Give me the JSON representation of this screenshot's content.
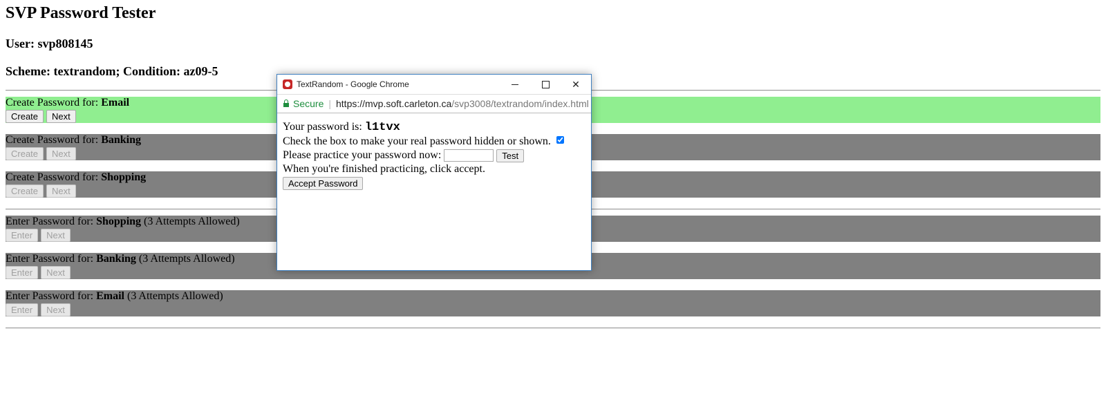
{
  "header": {
    "title": "SVP Password Tester",
    "user_line": "User: svp808145",
    "scheme_line": "Scheme: textrandom; Condition: az09-5"
  },
  "create_rows": [
    {
      "prefix": "Create Password for: ",
      "account": "Email",
      "create_label": "Create",
      "next_label": "Next",
      "state": "active"
    },
    {
      "prefix": "Create Password for: ",
      "account": "Banking",
      "create_label": "Create",
      "next_label": "Next",
      "state": "disabled"
    },
    {
      "prefix": "Create Password for: ",
      "account": "Shopping",
      "create_label": "Create",
      "next_label": "Next",
      "state": "disabled"
    }
  ],
  "enter_rows": [
    {
      "prefix": "Enter Password for: ",
      "account": "Shopping",
      "suffix": " (3 Attempts Allowed)",
      "enter_label": "Enter",
      "next_label": "Next"
    },
    {
      "prefix": "Enter Password for: ",
      "account": "Banking",
      "suffix": " (3 Attempts Allowed)",
      "enter_label": "Enter",
      "next_label": "Next"
    },
    {
      "prefix": "Enter Password for: ",
      "account": "Email",
      "suffix": " (3 Attempts Allowed)",
      "enter_label": "Enter",
      "next_label": "Next"
    }
  ],
  "popup": {
    "window_title": "TextRandom - Google Chrome",
    "secure_label": "Secure",
    "url_host": "https://mvp.soft.carleton.ca",
    "url_path": "/svp3008/textrandom/index.html",
    "password_prefix": "Your password is: ",
    "password_value": "l1tvx",
    "checkbox_text": "Check the box to make your real password hidden or shown.",
    "checkbox_checked": true,
    "practice_text": "Please practice your password now: ",
    "practice_value": "",
    "test_label": "Test",
    "finish_text": "When you're finished practicing, click accept.",
    "accept_label": "Accept Password"
  },
  "colors": {
    "active_row": "#90ee90",
    "disabled_row": "#808080",
    "window_border": "#3f7fbf",
    "secure_green": "#1e8e3e"
  }
}
